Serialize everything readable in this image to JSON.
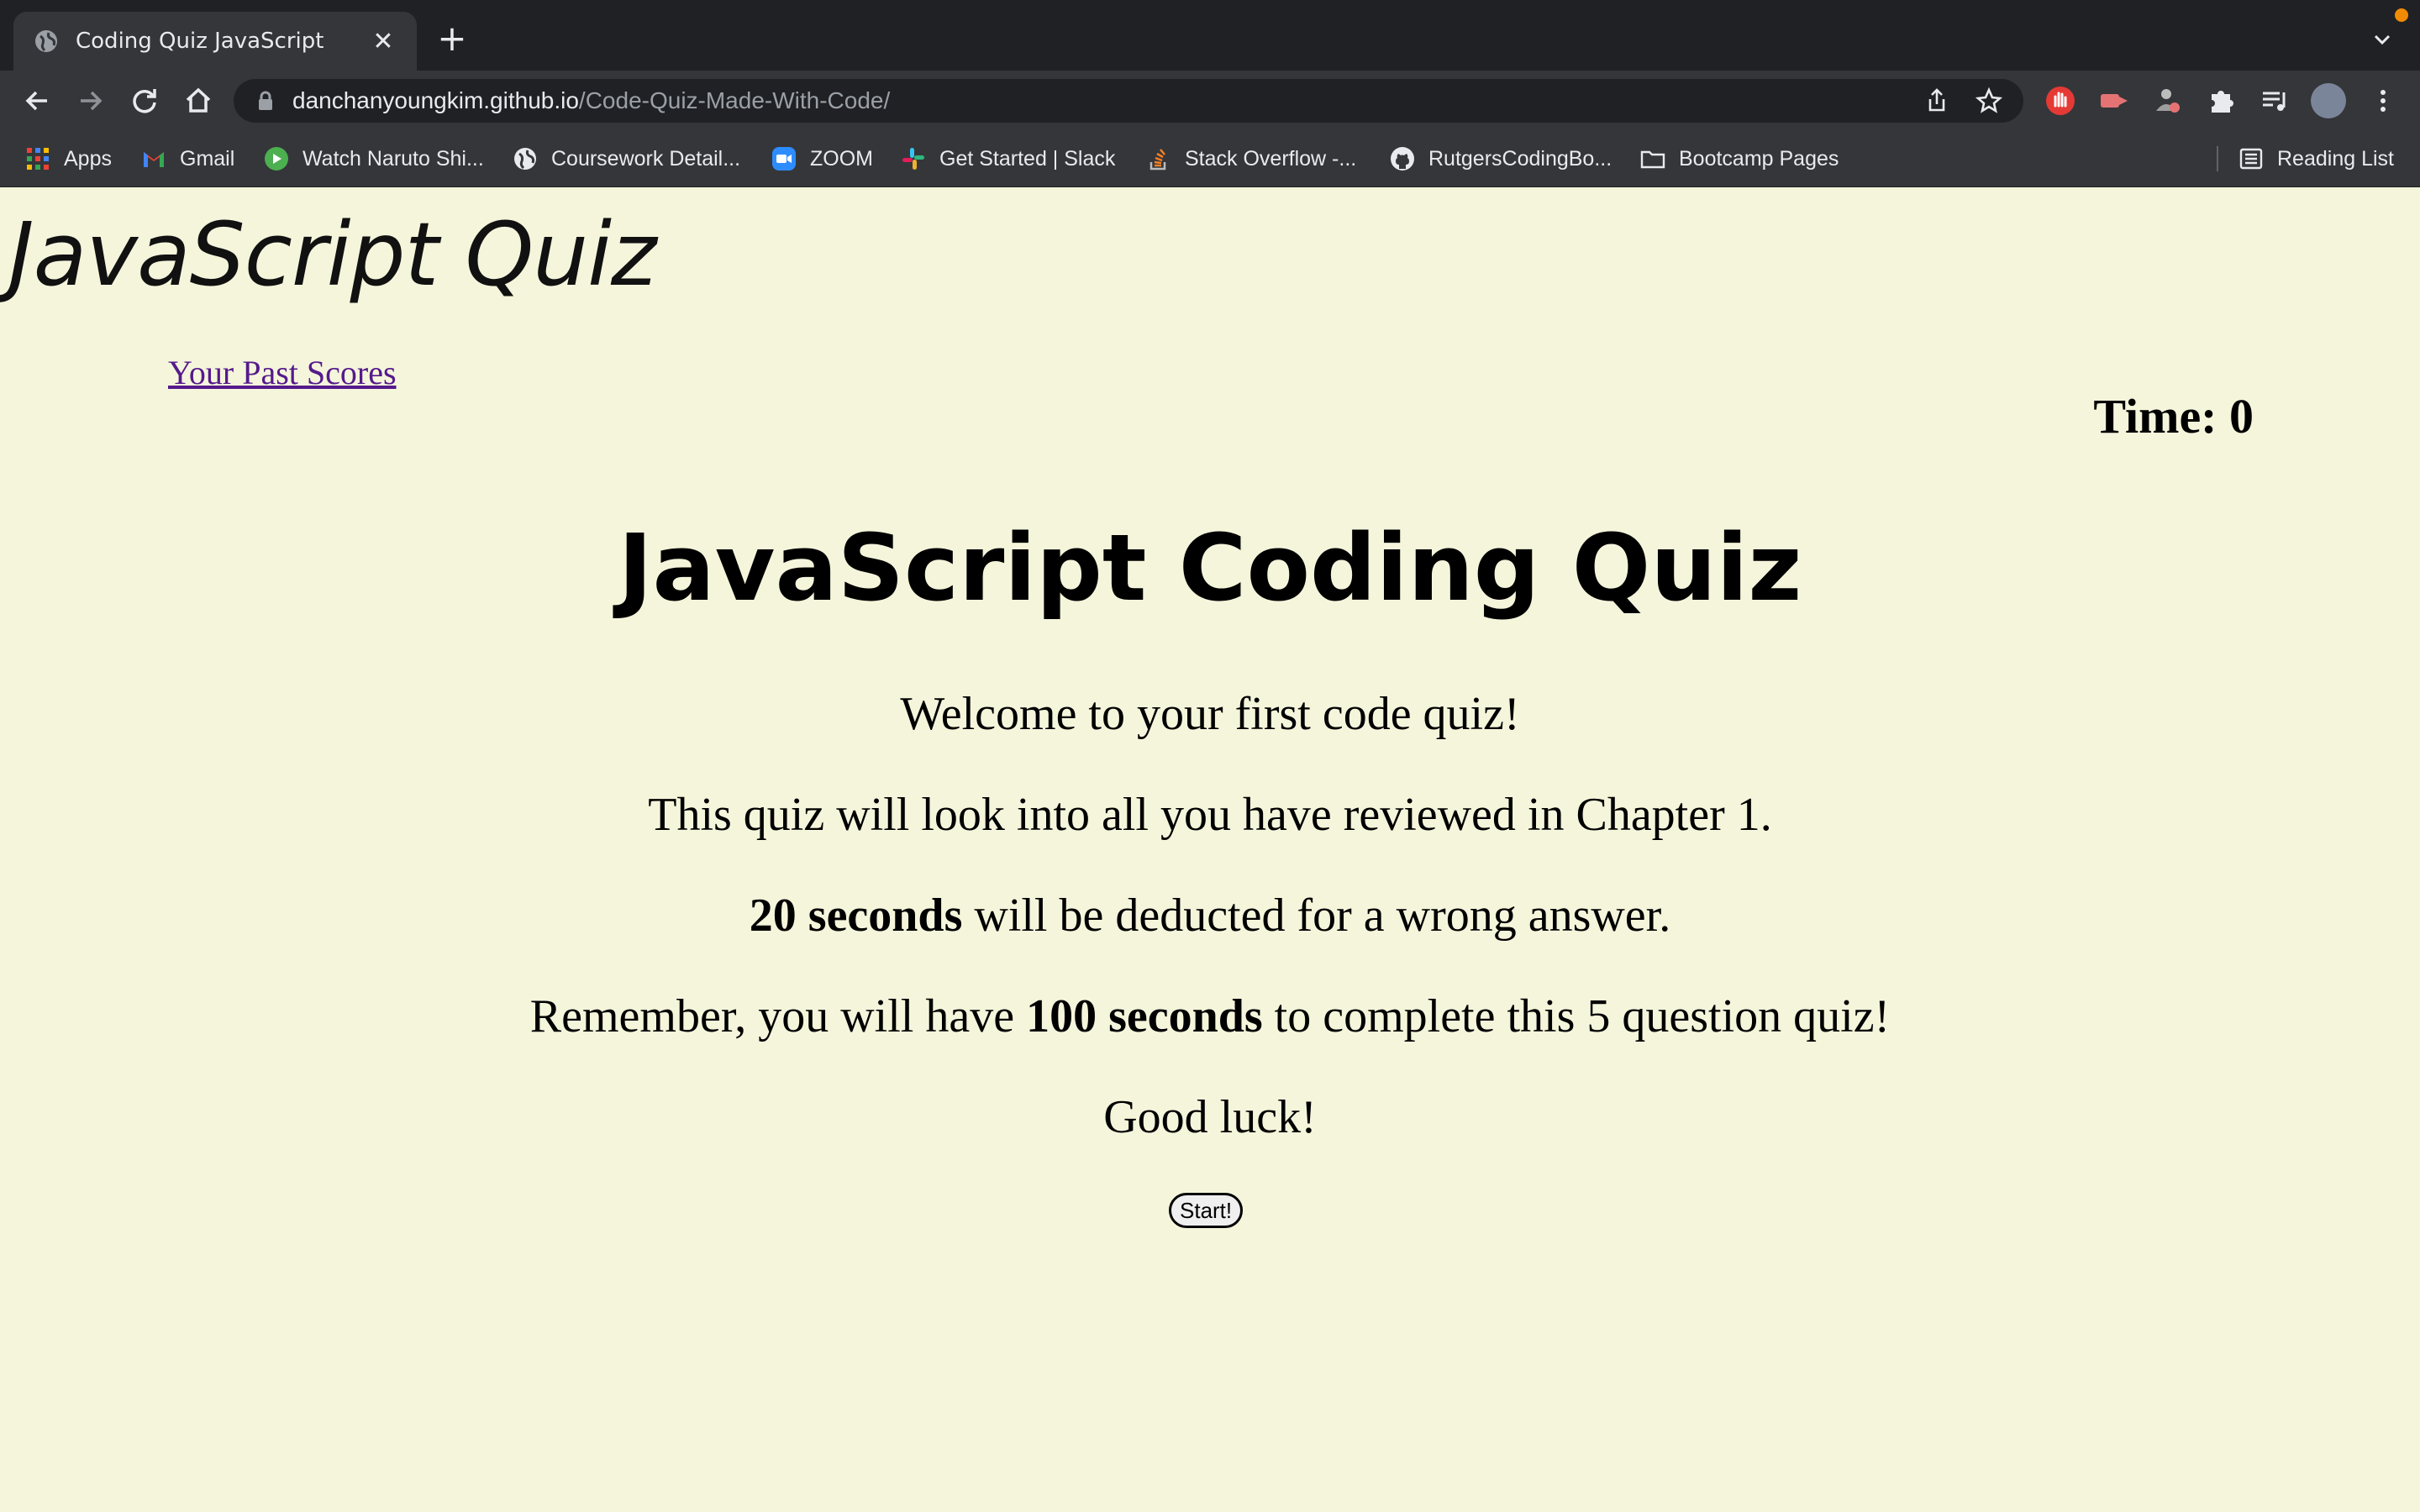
{
  "browser": {
    "tab_title": "Coding Quiz JavaScript",
    "url_host": "danchanyoungkim.github.io",
    "url_path": "/Code-Quiz-Made-With-Code/",
    "bookmarks": [
      {
        "label": "Apps",
        "icon": "apps-grid-icon"
      },
      {
        "label": "Gmail",
        "icon": "gmail-icon"
      },
      {
        "label": "Watch Naruto Shi...",
        "icon": "play-icon"
      },
      {
        "label": "Coursework Detail...",
        "icon": "globe-icon"
      },
      {
        "label": "ZOOM",
        "icon": "zoom-icon"
      },
      {
        "label": "Get Started | Slack",
        "icon": "slack-icon"
      },
      {
        "label": "Stack Overflow -...",
        "icon": "stackoverflow-icon"
      },
      {
        "label": "RutgersCodingBo...",
        "icon": "github-icon"
      },
      {
        "label": "Bootcamp Pages",
        "icon": "folder-icon"
      }
    ],
    "reading_list": "Reading List"
  },
  "page": {
    "site_title": "JavaScript Quiz",
    "past_scores_link": "Your Past Scores",
    "timer_label": "Time: ",
    "timer_value": "0",
    "heading": "JavaScript Coding Quiz",
    "welcome": "Welcome to your first code quiz!",
    "review": "This quiz will look into all you have reviewed in Chapter 1.",
    "penalty_bold": "20 seconds",
    "penalty_rest": " will be deducted for a wrong answer.",
    "remember_pre": "Remember, you will have ",
    "remember_bold": "100 seconds",
    "remember_post": " to complete this 5 question quiz!",
    "good_luck": "Good luck!",
    "start_button": "Start!"
  }
}
